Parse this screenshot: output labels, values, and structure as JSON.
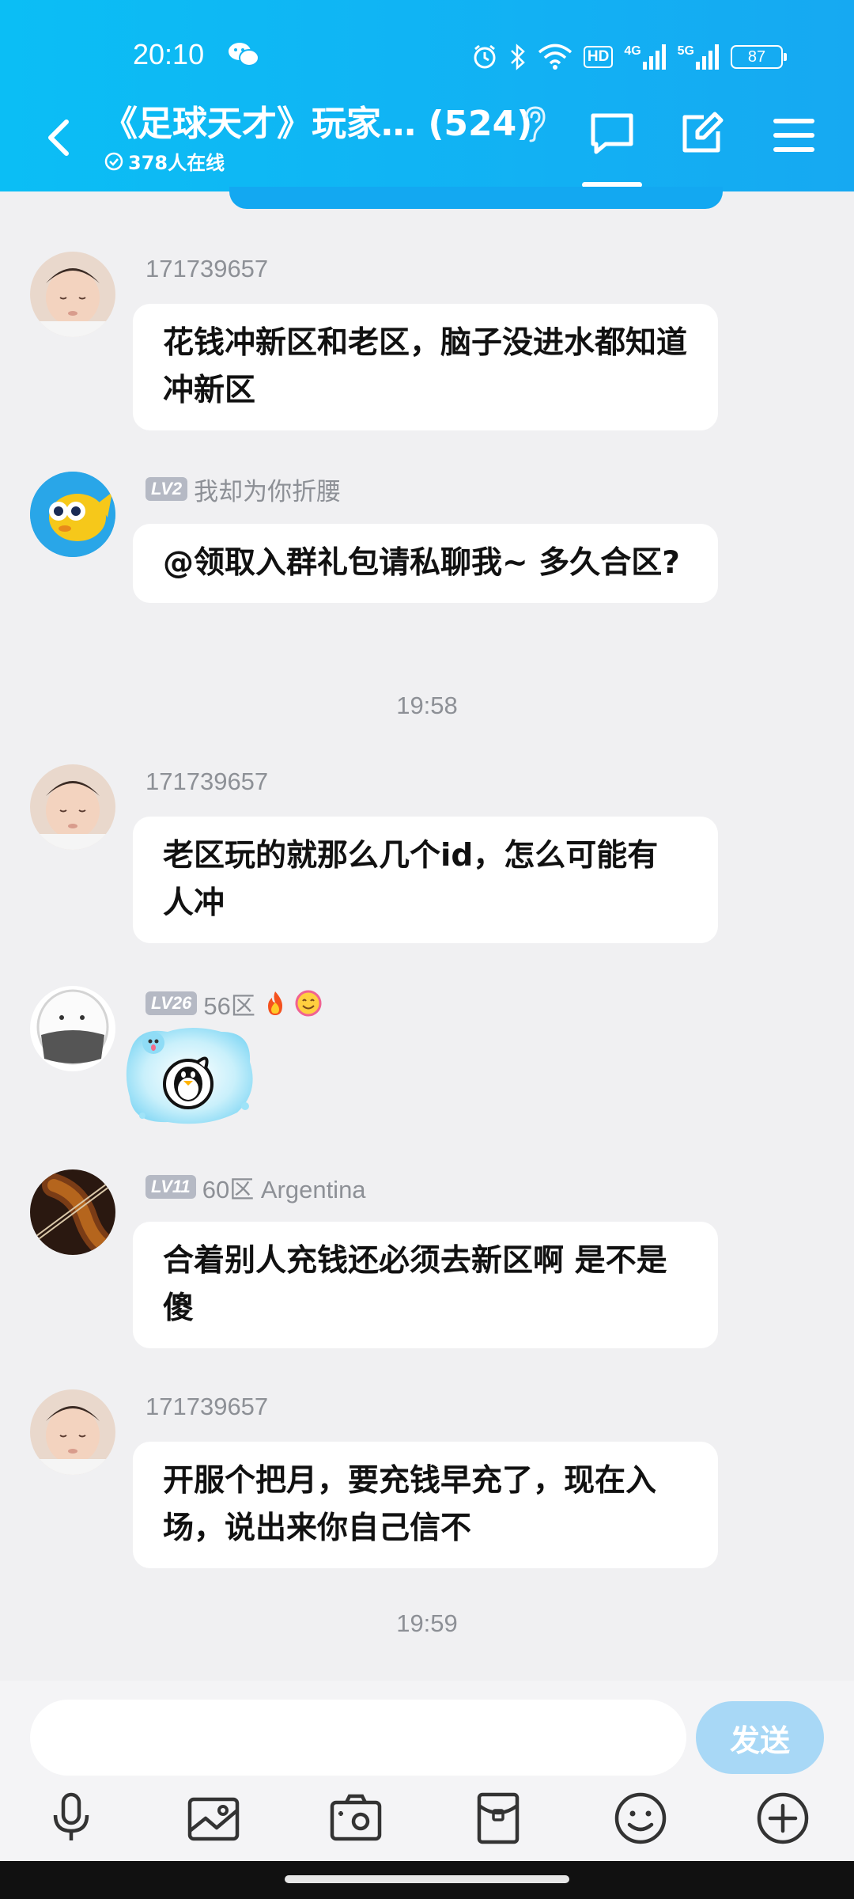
{
  "status_bar": {
    "time": "20:10",
    "network_labels": [
      "HD",
      "4G",
      "5G"
    ],
    "battery": "87",
    "icons": [
      "wechat-icon",
      "alarm-icon",
      "bluetooth-icon",
      "wifi-icon",
      "hd-icon",
      "signal-4g-icon",
      "signal-5g-icon",
      "battery-icon"
    ]
  },
  "header": {
    "title": "《足球天才》玩家… (524)",
    "online": "378人在线",
    "icons": [
      "back-icon",
      "ear-icon",
      "chat-tab-icon",
      "edit-icon",
      "menu-icon"
    ]
  },
  "messages": [
    {
      "sender": "171739657",
      "level": "",
      "text": "花钱冲新区和老区，脑子没进水都知道冲新区"
    },
    {
      "sender": "我却为你折腰",
      "level": "LV2",
      "text": "@领取入群礼包请私聊我~ 多久合区?"
    },
    {
      "time": "19:58"
    },
    {
      "sender": "171739657",
      "level": "",
      "text": "老区玩的就那么几个id，怎么可能有人冲"
    },
    {
      "sender": "56区",
      "level": "LV26",
      "sticker": "qq-penguin-sticker",
      "badges": [
        "fire-emoji",
        "smile-emoji"
      ]
    },
    {
      "sender": "60区 Argentina",
      "level": "LV11",
      "text": "合着别人充钱还必须去新区啊 是不是傻"
    },
    {
      "sender": "171739657",
      "level": "",
      "text": "开服个把月，要充钱早充了，现在入场，说出来你自己信不"
    },
    {
      "time": "19:59"
    }
  ],
  "input": {
    "value": "",
    "placeholder": "",
    "send_label": "发送"
  },
  "toolbar": [
    "mic-icon",
    "image-icon",
    "camera-icon",
    "red-packet-icon",
    "emoji-icon",
    "plus-icon"
  ],
  "colors": {
    "header": "#0bbef5",
    "send": "#a8d8f6",
    "background": "#f0f0f2",
    "bubble": "#ffffff"
  }
}
